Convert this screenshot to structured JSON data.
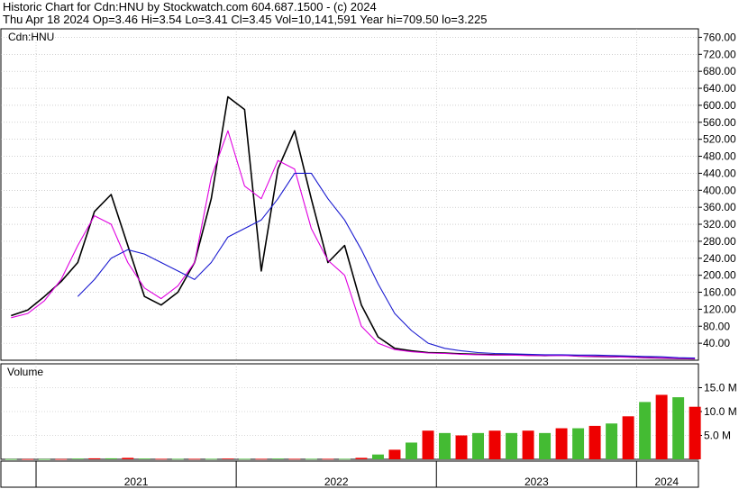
{
  "header": {
    "line1": "Historic Chart for Cdn:HNU by Stockwatch.com 604.687.1500 - (c) 2024",
    "line2": "Thu Apr 18 2024   Op=3.46   Hi=3.54   Lo=3.41   Cl=3.45   Vol=10,141,591   Year hi=709.50   lo=3.225"
  },
  "colors": {
    "price": "#000000",
    "ma_short": "#e000e0",
    "ma_long": "#1a1ad0",
    "vol_up": "#44bb33",
    "vol_down": "#ee0000",
    "grid": "#b4b4b4"
  },
  "chart_data": [
    {
      "type": "line",
      "panel": "price",
      "legend": "Cdn:HNU",
      "x_range": [
        "2020-11",
        "2024-04"
      ],
      "ylim": [
        0,
        780
      ],
      "yticks": [
        "40.00",
        "80.00",
        "120.00",
        "160.00",
        "200.00",
        "240.00",
        "280.00",
        "320.00",
        "360.00",
        "400.00",
        "440.00",
        "480.00",
        "520.00",
        "560.00",
        "600.00",
        "640.00",
        "680.00",
        "720.00",
        "760.00"
      ],
      "grid": true,
      "x": [
        "2020-11",
        "2020-12",
        "2021-01",
        "2021-02",
        "2021-03",
        "2021-04",
        "2021-05",
        "2021-06",
        "2021-07",
        "2021-08",
        "2021-09",
        "2021-10",
        "2021-11",
        "2021-12",
        "2022-01",
        "2022-02",
        "2022-03",
        "2022-04",
        "2022-05",
        "2022-06",
        "2022-07",
        "2022-08",
        "2022-09",
        "2022-10",
        "2022-11",
        "2022-12",
        "2023-01",
        "2023-02",
        "2023-03",
        "2023-04",
        "2023-05",
        "2023-06",
        "2023-07",
        "2023-08",
        "2023-09",
        "2023-10",
        "2023-11",
        "2023-12",
        "2024-01",
        "2024-02",
        "2024-03",
        "2024-04"
      ],
      "series": [
        {
          "values": [
            105,
            118,
            150,
            185,
            230,
            350,
            390,
            270,
            150,
            130,
            160,
            230,
            380,
            620,
            590,
            210,
            450,
            540,
            380,
            230,
            270,
            130,
            55,
            28,
            22,
            18,
            17,
            15,
            14,
            13,
            13,
            12,
            11,
            12,
            10,
            9,
            8,
            8,
            6,
            5,
            4,
            3.5
          ]
        },
        {
          "values": [
            100,
            110,
            140,
            190,
            270,
            340,
            320,
            230,
            170,
            145,
            175,
            230,
            430,
            540,
            410,
            380,
            470,
            450,
            310,
            235,
            200,
            80,
            40,
            25,
            20,
            17,
            16,
            14,
            13,
            12,
            12,
            11,
            11,
            11,
            10,
            9,
            8,
            7,
            6,
            5,
            4,
            3.5
          ]
        },
        {
          "values": [
            null,
            null,
            null,
            null,
            150,
            190,
            240,
            260,
            250,
            230,
            210,
            190,
            230,
            290,
            310,
            330,
            380,
            440,
            440,
            380,
            330,
            260,
            180,
            110,
            70,
            40,
            28,
            22,
            18,
            16,
            15,
            14,
            13,
            13,
            12,
            12,
            11,
            10,
            9,
            8,
            6,
            5
          ]
        }
      ]
    },
    {
      "type": "bar",
      "panel": "volume",
      "title": "Volume",
      "ylim": [
        0,
        20000000
      ],
      "yticks": [
        "5.0 M",
        "10.0 M",
        "15.0 M"
      ],
      "x": [
        "2020-11",
        "2020-12",
        "2021-01",
        "2021-02",
        "2021-03",
        "2021-04",
        "2021-05",
        "2021-06",
        "2021-07",
        "2021-08",
        "2021-09",
        "2021-10",
        "2021-11",
        "2021-12",
        "2022-01",
        "2022-02",
        "2022-03",
        "2022-04",
        "2022-05",
        "2022-06",
        "2022-07",
        "2022-08",
        "2022-09",
        "2022-10",
        "2022-11",
        "2022-12",
        "2023-01",
        "2023-02",
        "2023-03",
        "2023-04",
        "2023-05",
        "2023-06",
        "2023-07",
        "2023-08",
        "2023-09",
        "2023-10",
        "2023-11",
        "2023-12",
        "2024-01",
        "2024-02",
        "2024-03",
        "2024-04"
      ],
      "values": [
        0.05,
        0.05,
        0.05,
        0.06,
        0.15,
        0.2,
        0.2,
        0.3,
        0.15,
        0.1,
        0.1,
        0.1,
        0.1,
        0.15,
        0.1,
        0.1,
        0.15,
        0.1,
        0.1,
        0.1,
        0.1,
        0.3,
        1.0,
        2.0,
        3.5,
        6.0,
        5.5,
        5.0,
        5.5,
        6.0,
        5.5,
        6.0,
        5.5,
        6.5,
        6.5,
        7.0,
        7.5,
        9.0,
        12.0,
        13.5,
        13.0,
        11.0
      ]
    }
  ],
  "x_axis": {
    "years": [
      "2021",
      "2022",
      "2023",
      "2024"
    ]
  }
}
